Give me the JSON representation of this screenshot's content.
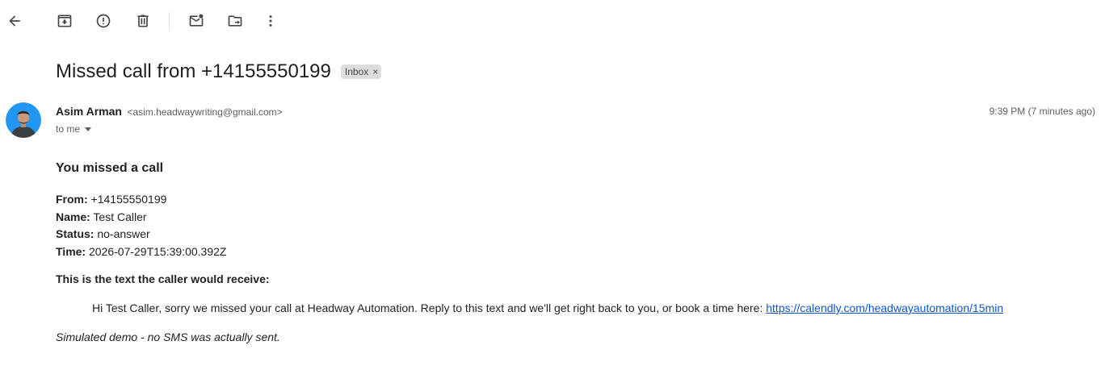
{
  "toolbar": {
    "buttons": [
      {
        "name": "back-button",
        "icon": "arrow-left-icon"
      },
      {
        "name": "archive-button",
        "icon": "archive-icon"
      },
      {
        "name": "report-spam-button",
        "icon": "report-icon"
      },
      {
        "name": "delete-button",
        "icon": "trash-icon"
      },
      {
        "name": "mark-unread-button",
        "icon": "mark-unread-icon"
      },
      {
        "name": "move-to-button",
        "icon": "move-to-folder-icon"
      },
      {
        "name": "more-button",
        "icon": "more-vert-icon"
      }
    ]
  },
  "email": {
    "subject": "Missed call from +14155550199",
    "label": "Inbox",
    "label_remove": "×",
    "sender_name": "Asim Arman",
    "sender_email": "<asim.headwaywriting@gmail.com>",
    "recipient": "to me",
    "timestamp": "9:39 PM (7 minutes ago)"
  },
  "message": {
    "heading": "You missed a call",
    "fields": [
      {
        "label": "From:",
        "value": " +14155550199"
      },
      {
        "label": "Name:",
        "value": " Test Caller"
      },
      {
        "label": "Status:",
        "value": " no-answer"
      },
      {
        "label": "Time:",
        "value": " 2026-07-29T15:39:00.392Z"
      }
    ],
    "sms_heading": "This is the text the caller would receive:",
    "sms_text": "Hi Test Caller, sorry we missed your call at Headway Automation. Reply to this text and we'll get right back to you, or book a time here: ",
    "sms_link": "https://calendly.com/headwayautomation/15min",
    "footnote": "Simulated demo - no SMS was actually sent."
  },
  "colors": {
    "link": "#1155cc",
    "avatar_bg": "#2196f3",
    "chip_bg": "#dddddd"
  }
}
